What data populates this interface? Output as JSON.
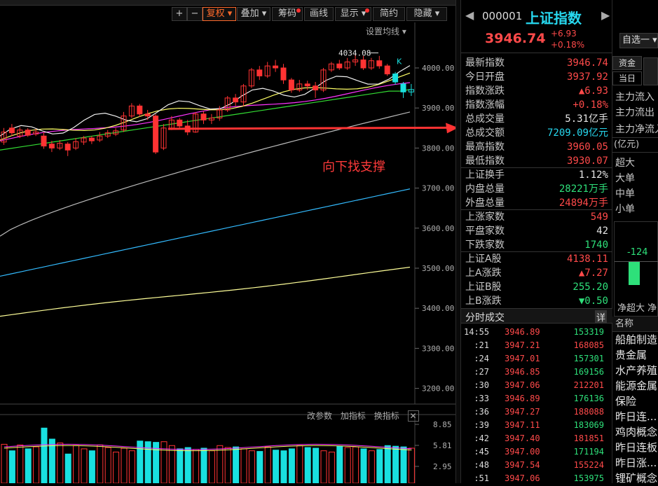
{
  "toolbar": {
    "plus": "+",
    "minus": "−",
    "restore": "复权",
    "overlay": "叠加",
    "chips": "筹码",
    "draw": "画线",
    "display": "显示",
    "simple": "简约",
    "hide": "隐藏"
  },
  "chart": {
    "ma_setting": "设置均线",
    "annotation": "向下找支撑",
    "high_label": "4034.08",
    "k_label": "K",
    "y_ticks": [
      "4000.00",
      "3900.00",
      "3800.00",
      "3700.00",
      "3600.00",
      "3500.00",
      "3400.00",
      "3300.00",
      "3200.00"
    ],
    "sub_ctrl": [
      "改参数",
      "加指标",
      "换指标"
    ],
    "sub_y_ticks": [
      "8.85",
      "5.81",
      "2.95"
    ],
    "colors": {
      "up": "#ff3333",
      "down": "#19e0e0",
      "ma5": "#f0f0f0",
      "ma10": "#ffff66",
      "ma20": "#ff33ff",
      "ma30": "#33dd33",
      "ma60": "#bbbbbb",
      "ma120": "#33bbff",
      "ma250": "#ffff99"
    }
  },
  "quote": {
    "code": "000001",
    "name": "上证指数",
    "price": "3946.74",
    "chg": "+6.93",
    "chg_pct": "+0.18%",
    "rows": [
      {
        "k": "最新指数",
        "v": "3946.74",
        "c": "red"
      },
      {
        "k": "今日开盘",
        "v": "3937.92",
        "c": "red"
      },
      {
        "k": "指数涨跌",
        "v": "▲6.93",
        "c": "red"
      },
      {
        "k": "指数涨幅",
        "v": "+0.18%",
        "c": "red"
      },
      {
        "k": "总成交量",
        "v": "5.31亿手",
        "c": "white"
      },
      {
        "k": "总成交额",
        "v": "7209.09亿元",
        "c": "cyan"
      },
      {
        "k": "最高指数",
        "v": "3960.05",
        "c": "red"
      },
      {
        "k": "最低指数",
        "v": "3930.07",
        "c": "red"
      },
      {
        "k": "上证换手",
        "v": "1.12%",
        "c": "white"
      },
      {
        "k": "内盘总量",
        "v": "28221万手",
        "c": "green"
      },
      {
        "k": "外盘总量",
        "v": "24894万手",
        "c": "red"
      },
      {
        "k": "上涨家数",
        "v": "549",
        "c": "red"
      },
      {
        "k": "平盘家数",
        "v": "42",
        "c": "white"
      },
      {
        "k": "下跌家数",
        "v": "1740",
        "c": "green"
      },
      {
        "k": "上证A股",
        "v": "4138.11",
        "c": "red"
      },
      {
        "k": "上A涨跌",
        "v": "▲7.27",
        "c": "red"
      },
      {
        "k": "上证B股",
        "v": "255.20",
        "c": "green"
      },
      {
        "k": "上B涨跌",
        "v": "▼0.50",
        "c": "green"
      }
    ],
    "ticks_title": "分时成交",
    "ticks_detail": "详",
    "ticks": [
      {
        "t": "14:55",
        "p": "3946.89",
        "v": "153319",
        "c": "green"
      },
      {
        "t": ":21",
        "p": "3947.21",
        "v": "168085",
        "c": "red"
      },
      {
        "t": ":24",
        "p": "3947.01",
        "v": "157301",
        "c": "green"
      },
      {
        "t": ":27",
        "p": "3946.85",
        "v": "169156",
        "c": "green"
      },
      {
        "t": ":30",
        "p": "3947.06",
        "v": "212201",
        "c": "red"
      },
      {
        "t": ":33",
        "p": "3946.89",
        "v": "176136",
        "c": "green"
      },
      {
        "t": ":36",
        "p": "3947.27",
        "v": "188088",
        "c": "red"
      },
      {
        "t": ":39",
        "p": "3947.11",
        "v": "183069",
        "c": "green"
      },
      {
        "t": ":42",
        "p": "3947.40",
        "v": "181851",
        "c": "red"
      },
      {
        "t": ":45",
        "p": "3947.00",
        "v": "171194",
        "c": "green"
      },
      {
        "t": ":48",
        "p": "3947.54",
        "v": "155224",
        "c": "red"
      },
      {
        "t": ":51",
        "p": "3947.06",
        "v": "153975",
        "c": "green"
      }
    ]
  },
  "right": {
    "zixuan": "自选一",
    "tab_fund": "资金",
    "tab_today": "当日",
    "flow": [
      "主力流入",
      "主力流出",
      "主力净流入"
    ],
    "unit": "(亿元)",
    "sizes": [
      "超大",
      "大单",
      "中单",
      "小单"
    ],
    "bar_value": "-124",
    "net_labels": "净超大 净",
    "list_header": "名称",
    "sectors": [
      "船舶制造",
      "贵金属",
      "水产养殖",
      "能源金属",
      "保险",
      "昨日连...",
      "鸡肉概念",
      "昨日连板",
      "昨日涨...",
      "锂矿概念"
    ]
  }
}
